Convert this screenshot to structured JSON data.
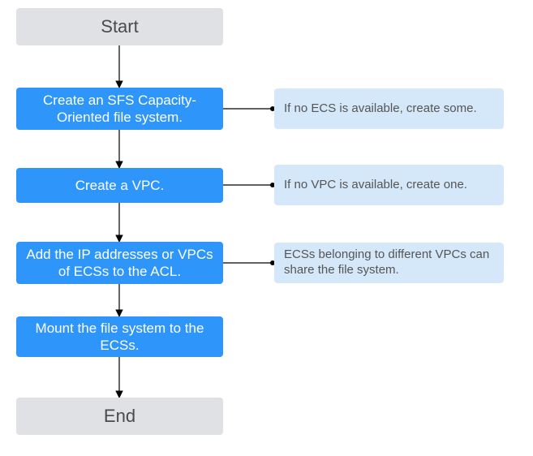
{
  "flow": {
    "start": "Start",
    "step1": "Create an SFS Capacity-Oriented file system.",
    "step2": "Create a VPC.",
    "step3": "Add the IP addresses or VPCs of ECSs to the ACL.",
    "step4": "Mount the file system to the ECSs.",
    "end": "End"
  },
  "notes": {
    "n1": "If no ECS is available, create some.",
    "n2": "If no VPC is available, create one.",
    "n3": "ECSs belonging to different VPCs can share the file system."
  },
  "chart_data": {
    "type": "flowchart",
    "nodes": [
      {
        "id": "start",
        "kind": "terminator",
        "label": "Start"
      },
      {
        "id": "s1",
        "kind": "process",
        "label": "Create an SFS Capacity-Oriented file system."
      },
      {
        "id": "s2",
        "kind": "process",
        "label": "Create a VPC."
      },
      {
        "id": "s3",
        "kind": "process",
        "label": "Add the IP addresses or VPCs of ECSs to the ACL."
      },
      {
        "id": "s4",
        "kind": "process",
        "label": "Mount the file system to the ECSs."
      },
      {
        "id": "end",
        "kind": "terminator",
        "label": "End"
      },
      {
        "id": "n1",
        "kind": "annotation",
        "label": "If no ECS is available, create some."
      },
      {
        "id": "n2",
        "kind": "annotation",
        "label": "If no VPC is available, create one."
      },
      {
        "id": "n3",
        "kind": "annotation",
        "label": "ECSs belonging to different VPCs can share the file system."
      }
    ],
    "edges": [
      {
        "from": "start",
        "to": "s1",
        "style": "arrow"
      },
      {
        "from": "s1",
        "to": "s2",
        "style": "arrow"
      },
      {
        "from": "s2",
        "to": "s3",
        "style": "arrow"
      },
      {
        "from": "s3",
        "to": "s4",
        "style": "arrow"
      },
      {
        "from": "s4",
        "to": "end",
        "style": "arrow"
      },
      {
        "from": "s1",
        "to": "n1",
        "style": "line-dot"
      },
      {
        "from": "s2",
        "to": "n2",
        "style": "line-dot"
      },
      {
        "from": "s3",
        "to": "n3",
        "style": "line-dot"
      }
    ]
  }
}
